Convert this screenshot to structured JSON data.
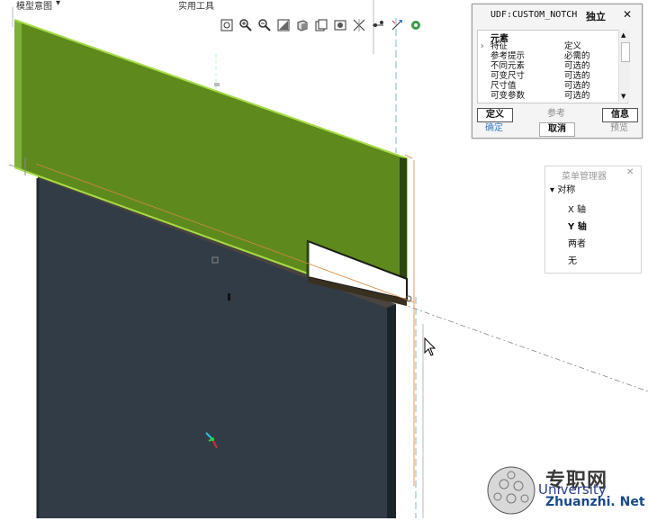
{
  "menubar": {
    "model_tree_label": "模型意图",
    "practical_tools_label": "实用工具"
  },
  "toolbar": {
    "icons": [
      "zoom-fit-icon",
      "zoom-in-icon",
      "zoom-out-icon",
      "repaint-icon",
      "shading-icon",
      "saved-views-icon",
      "display-style-icon",
      "datum-display-icon",
      "spin-center-icon",
      "annotation-icon",
      "settings-icon"
    ]
  },
  "udf_dialog": {
    "title": "UDF:CUSTOM_NOTCH",
    "mode": "独立",
    "close": "✕",
    "col_element": "元素",
    "col_info": "信息",
    "rows": [
      {
        "element": "特征",
        "info": "定义"
      },
      {
        "element": "参考提示",
        "info": "必需的"
      },
      {
        "element": "不同元素",
        "info": "可选的"
      },
      {
        "element": "可变尺寸",
        "info": "可选的"
      },
      {
        "element": "尺寸值",
        "info": "可选的"
      },
      {
        "element": "可变参数",
        "info": "可选的"
      },
      {
        "element": "...",
        "info": "..."
      }
    ],
    "buttons": {
      "define": "定义",
      "reference": "参考",
      "info": "信息",
      "ok": "确定",
      "cancel": "取消",
      "preview": "预览"
    }
  },
  "menu_manager": {
    "title": "菜单管理器",
    "close": "✕",
    "section": "对称",
    "items": [
      "X 轴",
      "Y 轴",
      "两者",
      "无"
    ],
    "selected_index": 1
  },
  "watermark": {
    "cn": "专职网",
    "en": "University",
    "url": "Zhuanzhi. Net"
  },
  "colors": {
    "green_panel": "#5e8a1d",
    "green_edge": "#9ad13a",
    "dark_panel": "#2f3a44",
    "accent_blue": "#3a7fc4"
  }
}
